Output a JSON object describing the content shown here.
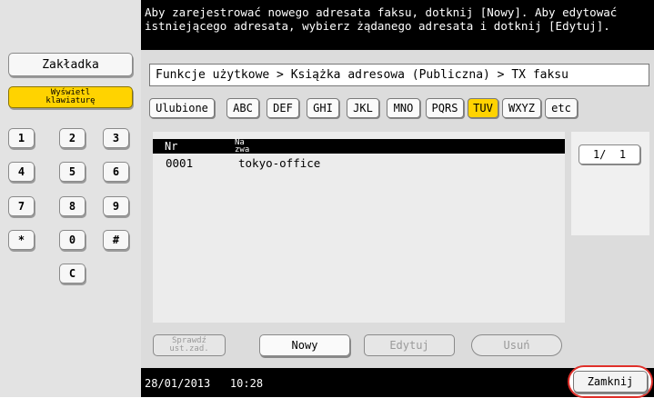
{
  "message": "Aby zarejestrować nowego adresata faksu, dotknij [Nowy]. Aby edytować\nistniejącego adresata, wybierz żądanego adresata i dotknij [Edytuj].",
  "left_panel": {
    "bookmark_label": "Zakładka",
    "keyboard_label": "Wyświetl\nklawiaturę",
    "keys": [
      "1",
      "2",
      "3",
      "4",
      "5",
      "6",
      "7",
      "8",
      "9",
      "*",
      "0",
      "#",
      "C"
    ]
  },
  "breadcrumb": "Funkcje użytkowe > Książka adresowa (Publiczna) > TX faksu",
  "index_tabs": [
    "Ulubione",
    "ABC",
    "DEF",
    "GHI",
    "JKL",
    "MNO",
    "PQRS",
    "TUV",
    "WXYZ",
    "etc"
  ],
  "selected_tab": "TUV",
  "list": {
    "headers": {
      "nr": "Nr",
      "name": "Na\nzwa"
    },
    "rows": [
      {
        "nr": "0001",
        "name": "tokyo-office"
      }
    ]
  },
  "pager": "1/  1",
  "buttons": {
    "check": "Sprawdź\nust.zad.",
    "new": "Nowy",
    "edit": "Edytuj",
    "delete": "Usuń"
  },
  "status": {
    "datetime": "28/01/2013   10:28",
    "close": "Zamknij"
  },
  "colors": {
    "selected": "#ffd300",
    "bars": "#000000",
    "close_highlight": "#e0302a"
  }
}
